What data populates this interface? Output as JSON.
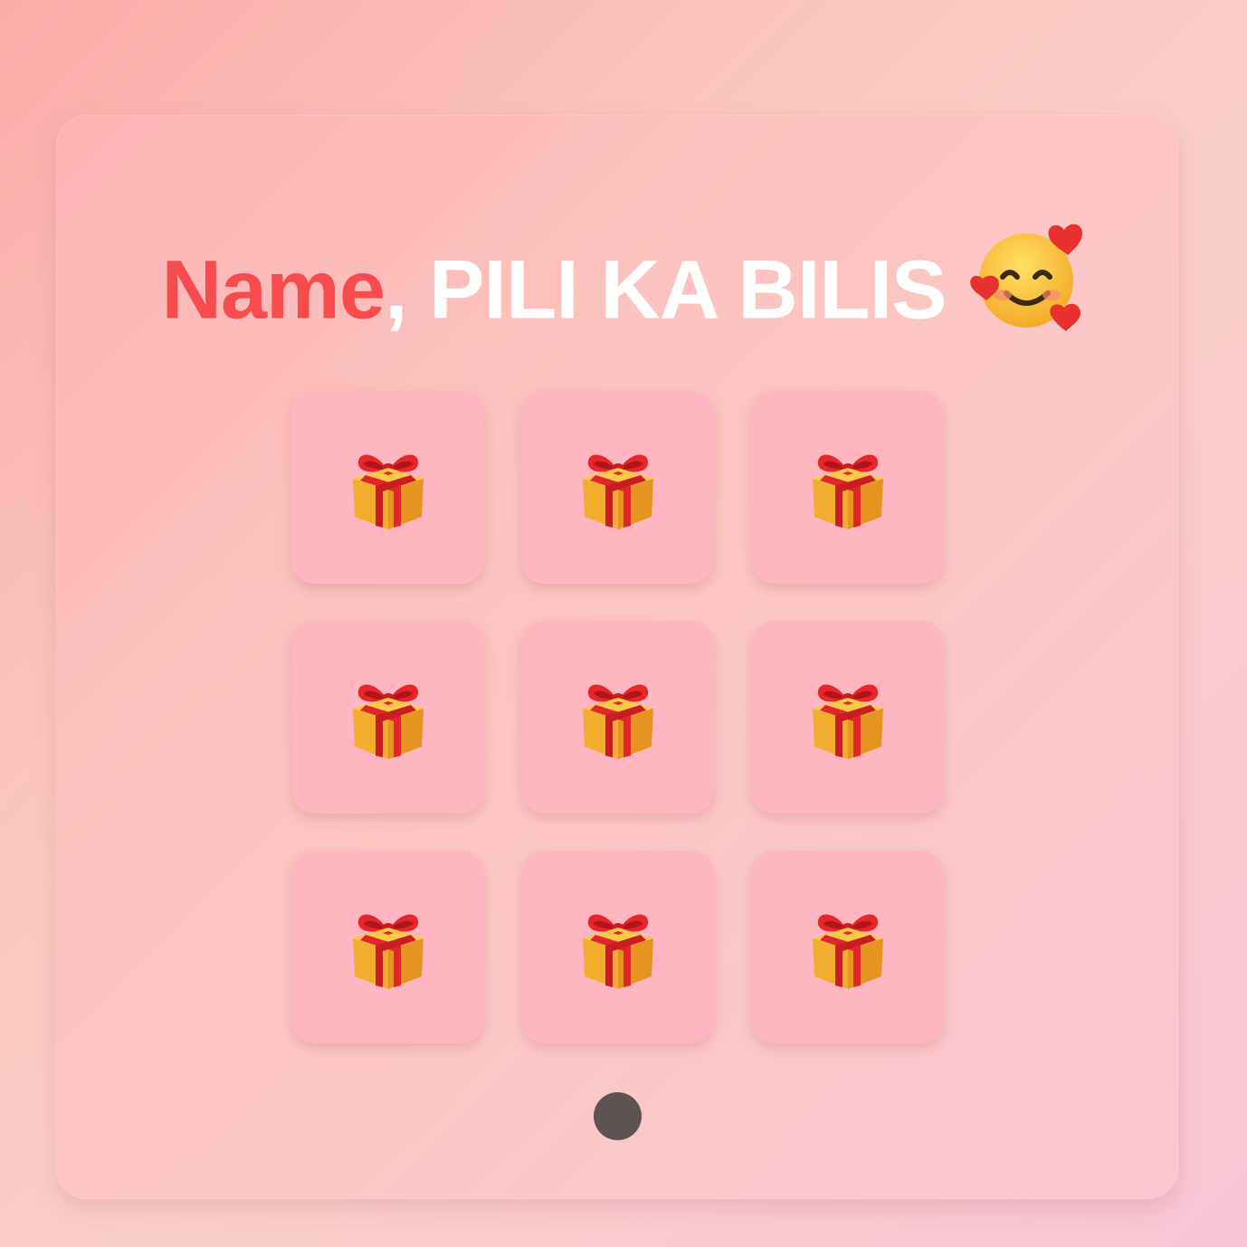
{
  "title": {
    "name": "Name",
    "comma": ",",
    "rest": " PILI KA BILIS",
    "emoji": "smiling-face-with-hearts-icon"
  },
  "tiles": [
    {
      "icon": "gift-icon"
    },
    {
      "icon": "gift-icon"
    },
    {
      "icon": "gift-icon"
    },
    {
      "icon": "gift-icon"
    },
    {
      "icon": "gift-icon"
    },
    {
      "icon": "gift-icon"
    },
    {
      "icon": "gift-icon"
    },
    {
      "icon": "gift-icon"
    },
    {
      "icon": "gift-icon"
    }
  ],
  "colors": {
    "name": "#f74b4e",
    "title": "#ffffff",
    "tile": "#ffb6c1",
    "dot": "#5f5252"
  }
}
